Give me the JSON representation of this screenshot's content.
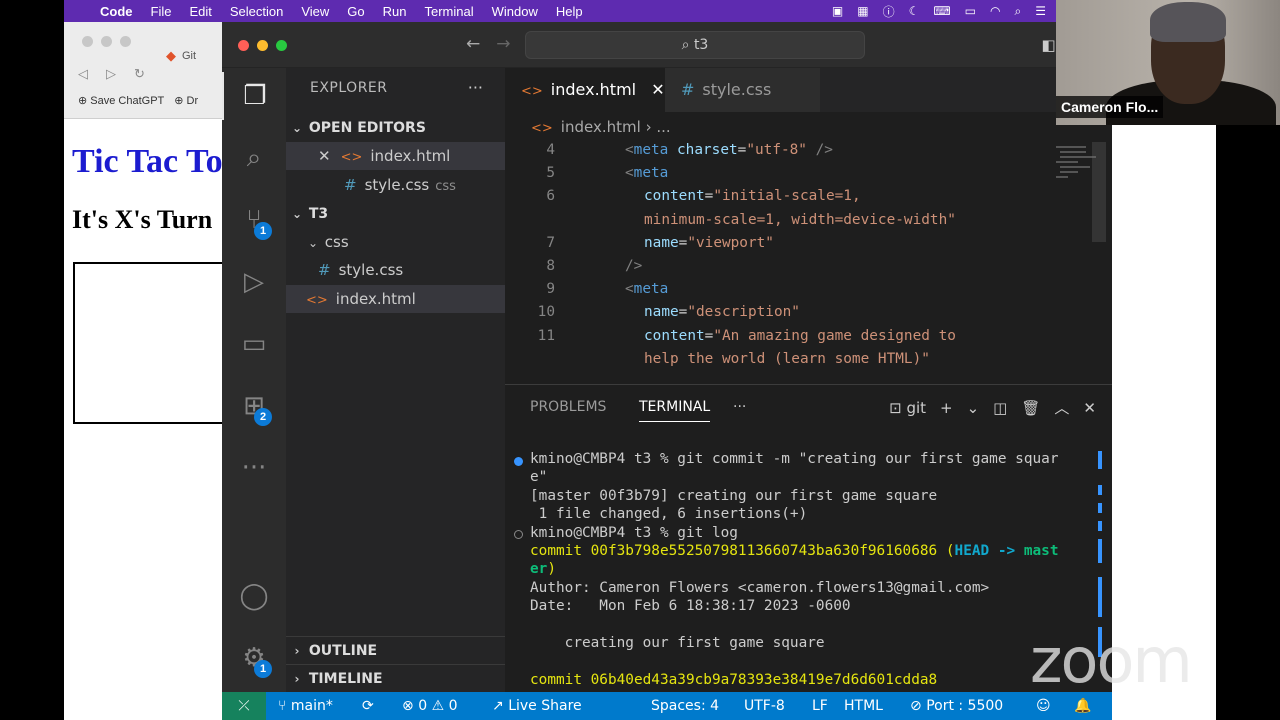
{
  "menubar": {
    "app": "Code",
    "items": [
      "File",
      "Edit",
      "Selection",
      "View",
      "Go",
      "Run",
      "Terminal",
      "Window",
      "Help"
    ]
  },
  "browser": {
    "tab_title": "Git",
    "bookmarks": [
      "Save ChatGPT",
      "Dr"
    ],
    "page_title": "Tic Tac To",
    "turn_text": "It's X's Turn"
  },
  "vscode": {
    "command_center": "t3",
    "explorer_title": "EXPLORER",
    "open_editors_title": "OPEN EDITORS",
    "open_editors": [
      {
        "name": "index.html"
      },
      {
        "name": "style.css",
        "hint": "css"
      }
    ],
    "project_title": "T3",
    "tree": {
      "folder": "css",
      "folder_file": "style.css",
      "root_file": "index.html"
    },
    "outline_title": "OUTLINE",
    "timeline_title": "TIMELINE",
    "tabs": [
      "index.html",
      "style.css"
    ],
    "breadcrumb": {
      "file": "index.html",
      "rest": "..."
    },
    "badges": {
      "scm": "1",
      "extensions": "2",
      "settings": "1"
    },
    "editor_lines": [
      {
        "n": "4",
        "p": [
          "<",
          "meta",
          " ",
          "charset",
          "=",
          "\"utf-8\"",
          " />"
        ]
      },
      {
        "n": "5",
        "p": [
          "<",
          "meta"
        ]
      },
      {
        "n": "6",
        "p": [
          "content",
          "=",
          "\"initial-scale=1,"
        ]
      },
      {
        "n": "",
        "p": [
          "minimum-scale=1, width=device-width\""
        ]
      },
      {
        "n": "7",
        "p": [
          "name",
          "=",
          "\"viewport\""
        ]
      },
      {
        "n": "8",
        "p": [
          "/>"
        ]
      },
      {
        "n": "9",
        "p": [
          "<",
          "meta"
        ]
      },
      {
        "n": "10",
        "p": [
          "name",
          "=",
          "\"description\""
        ]
      },
      {
        "n": "11",
        "p": [
          "content",
          "=",
          "\"An amazing game designed to"
        ]
      },
      {
        "n": "",
        "p": [
          "help the world (learn some HTML)\""
        ]
      }
    ],
    "panel": {
      "tabs": [
        "PROBLEMS",
        "TERMINAL"
      ],
      "more": "···",
      "shell": "git"
    },
    "terminal": {
      "prompt1": "kmino@CMBP4 t3 % git commit -m \"creating our first game squar",
      "prompt1_wrap": "e\"",
      "out1": "[master 00f3b79] creating our first game square",
      "out2": " 1 file changed, 6 insertions(+)",
      "prompt2": "kmino@CMBP4 t3 % git log",
      "commit1_label": "commit 00f3b798e55250798113660743ba630f96160686 (",
      "commit1_head": "HEAD -> ",
      "commit1_branch": "mast",
      "commit1_branch_wrap": "er",
      "commit1_close": ")",
      "author": "Author: Cameron Flowers <cameron.flowers13@gmail.com>",
      "date": "Date:   Mon Feb 6 18:38:17 2023 -0600",
      "message": "    creating our first game square",
      "commit2": "commit 06b40ed43a39cb9a78393e38419e7d6d601cdda8"
    },
    "status": {
      "branch": "main*",
      "errors": "0",
      "warnings": "0",
      "live_share": "Live Share",
      "spaces": "Spaces: 4",
      "encoding": "UTF-8",
      "eol": "LF",
      "language": "HTML",
      "port": "Port : 5500"
    }
  },
  "video": {
    "participant": "Cameron Flo..."
  },
  "watermark": "zoom",
  "colors": {
    "menubar": "#5e2bb0",
    "statusbar": "#007acc",
    "page_title": "#1c1cd0"
  }
}
